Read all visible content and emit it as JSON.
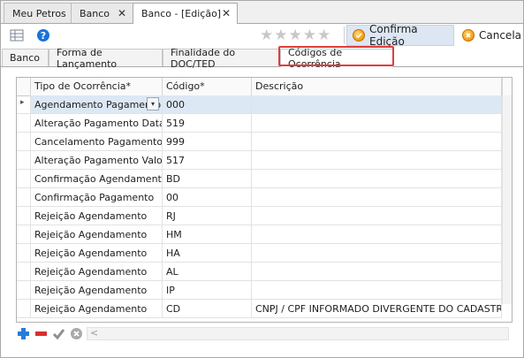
{
  "doc_tabs": [
    {
      "label": "Meu Petros",
      "closable": false
    },
    {
      "label": "Banco",
      "closable": true
    },
    {
      "label": "Banco - [Edição]",
      "closable": true,
      "active": true
    }
  ],
  "toolbar": {
    "rating_stars": "★★★★★",
    "confirm_label": "Confirma Edição",
    "cancel_label": "Cancela"
  },
  "form_tabs": [
    {
      "label": "Banco"
    },
    {
      "label": "Forma de Lançamento"
    },
    {
      "label": "Finalidade do DOC/TED"
    },
    {
      "label": "Códigos de Ocorrência",
      "active": true
    }
  ],
  "grid": {
    "columns": [
      "Tipo de Ocorrência*",
      "Código*",
      "Descrição"
    ],
    "rows": [
      {
        "tipo": "Agendamento Pagamento",
        "codigo": "000",
        "descricao": ""
      },
      {
        "tipo": "Alteração Pagamento Data",
        "codigo": "519",
        "descricao": ""
      },
      {
        "tipo": "Cancelamento Pagamento",
        "codigo": "999",
        "descricao": ""
      },
      {
        "tipo": "Alteração Pagamento Valor",
        "codigo": "517",
        "descricao": ""
      },
      {
        "tipo": "Confirmação Agendamento",
        "codigo": "BD",
        "descricao": ""
      },
      {
        "tipo": "Confirmação Pagamento",
        "codigo": "00",
        "descricao": ""
      },
      {
        "tipo": "Rejeição Agendamento",
        "codigo": "RJ",
        "descricao": ""
      },
      {
        "tipo": "Rejeição Agendamento",
        "codigo": "HM",
        "descricao": ""
      },
      {
        "tipo": "Rejeição Agendamento",
        "codigo": "HA",
        "descricao": ""
      },
      {
        "tipo": "Rejeição Agendamento",
        "codigo": "AL",
        "descricao": ""
      },
      {
        "tipo": "Rejeição Agendamento",
        "codigo": "IP",
        "descricao": ""
      },
      {
        "tipo": "Rejeição Agendamento",
        "codigo": "CD",
        "descricao": "CNPJ / CPF INFORMADO DIVERGENTE DO CADASTRADO"
      }
    ],
    "row_indicator": "▸",
    "combo_arrow": "▾"
  },
  "footer": {
    "add_icon": "plus-icon",
    "remove_icon": "minus-icon",
    "apply_icon": "check-icon",
    "discard_icon": "cancel-circle-icon",
    "scroll_left": "<"
  },
  "colors": {
    "selection": "#dde8f5",
    "highlight": "#e03c3c",
    "confirm_bg": "#dde7f3",
    "orb": "#f39a10"
  }
}
